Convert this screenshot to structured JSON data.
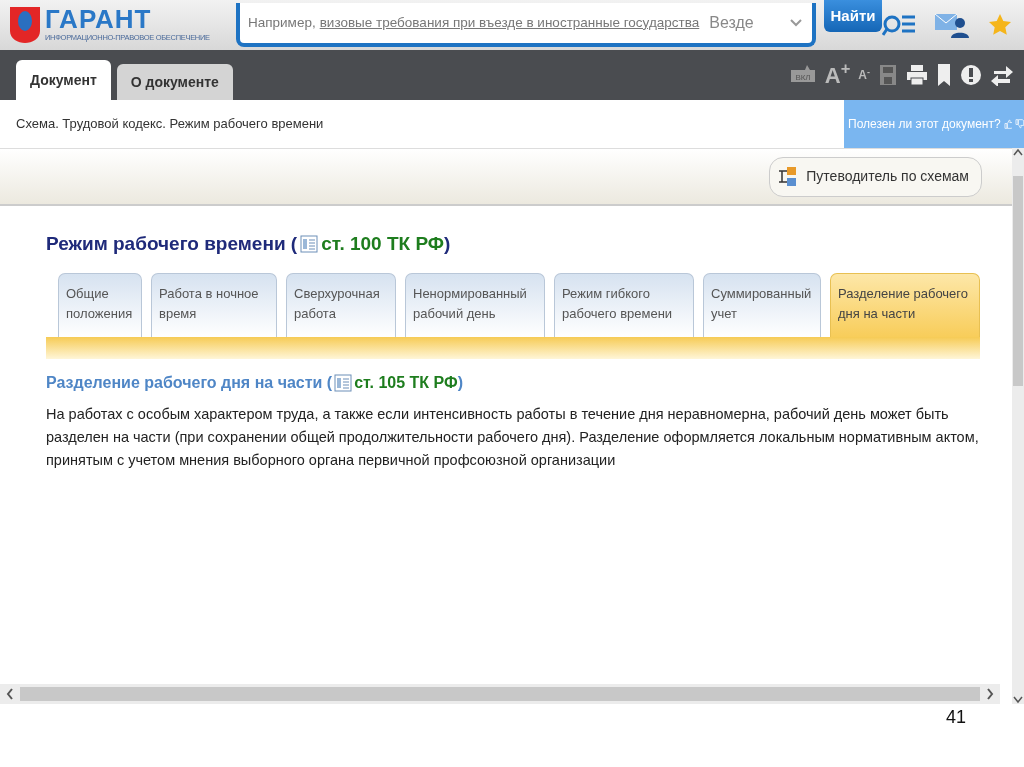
{
  "header": {
    "logo_text": "ГАРАНТ",
    "logo_tagline": "ИНФОРМАЦИОННО-ПРАВОВОЕ ОБЕСПЕЧЕНИЕ",
    "search": {
      "hint": "Например,",
      "example": "визовые требования при въезде в иностранные государства"
    },
    "scope": "Везде",
    "search_button": "Найти"
  },
  "doc_tabs": [
    {
      "label": "Документ",
      "selected": true
    },
    {
      "label": "О документе",
      "selected": false
    }
  ],
  "toolbar": {
    "voice_label": "ВКЛ",
    "font_bigger": "A$^{+}$",
    "font_smaller": "A$^{-}$"
  },
  "breadcrumb": "Схема. Трудовой кодекс. Режим рабочего времени",
  "feedback": "Полезен ли этот документ?",
  "guide_button": "Путеводитель по схемам",
  "title": {
    "text": "Режим рабочего времени (",
    "link": "ст. 100 ТК РФ",
    "close": ")"
  },
  "topic_tabs": [
    {
      "label": "Общие положения",
      "selected": false
    },
    {
      "label": "Работа в ночное время",
      "selected": false
    },
    {
      "label": "Сверхурочная работа",
      "selected": false
    },
    {
      "label": "Ненормированный рабочий день",
      "selected": false
    },
    {
      "label": "Режим гибкого рабочего времени",
      "selected": false
    },
    {
      "label": "Суммированный учет",
      "selected": false
    },
    {
      "label": "Разделение рабочего дня на части",
      "selected": true
    }
  ],
  "section": {
    "heading": "Разделение рабочего дня на части (",
    "link": "ст. 105 ТК РФ",
    "close": ")",
    "text": "На работах с особым характером труда, а также если интенсивность работы в течение дня неравномерна, рабочий день может быть разделен на части (при сохранении общей продолжительности рабочего дня). Разделение оформляется локальным нормативным актом, принятым с учетом мнения выборного органа первичной профсоюзной организации"
  },
  "slide_number": "41"
}
